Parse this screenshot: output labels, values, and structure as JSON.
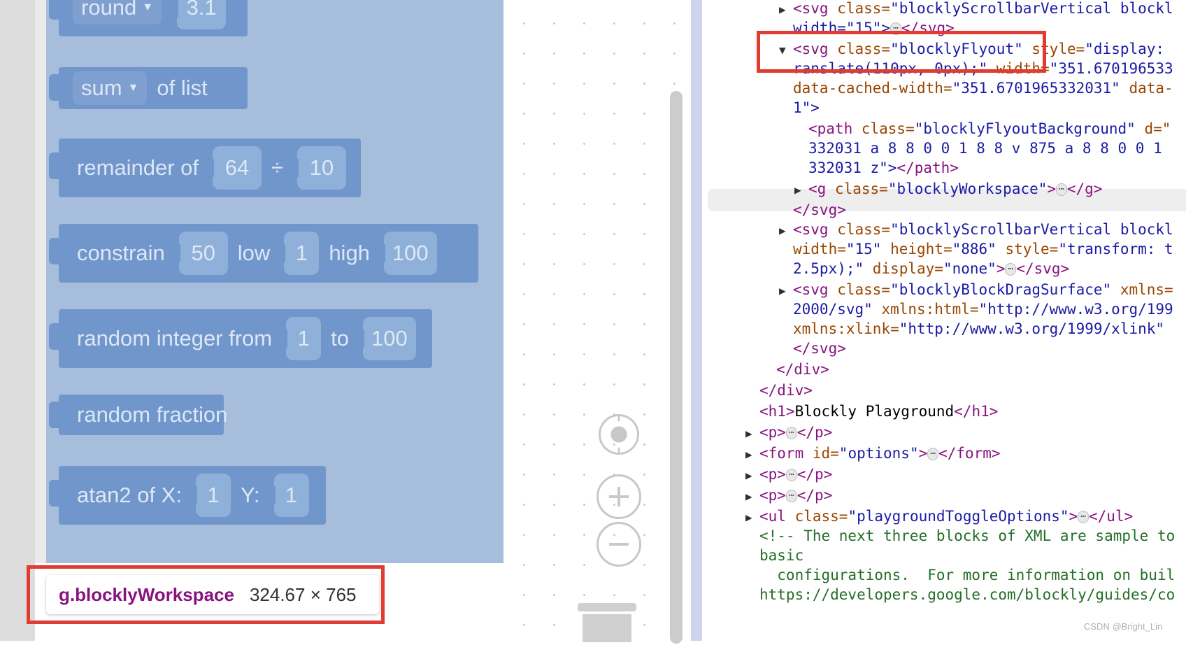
{
  "flyout_blocks": {
    "round": {
      "dropdown": "round",
      "value": "3.1"
    },
    "sum": {
      "dropdown": "sum",
      "label": "of list"
    },
    "remainder": {
      "label": "remainder of",
      "a": "64",
      "op": "÷",
      "b": "10"
    },
    "constrain": {
      "label": "constrain",
      "value": "50",
      "low_label": "low",
      "low": "1",
      "high_label": "high",
      "high": "100"
    },
    "random_int": {
      "label": "random integer from",
      "from": "1",
      "to_label": "to",
      "to": "100"
    },
    "random_fraction": {
      "label": "random fraction"
    },
    "atan2": {
      "label": "atan2 of X:",
      "x": "1",
      "y_label": "Y:",
      "y": "1"
    }
  },
  "tooltip": {
    "name": "g.blocklyWorkspace",
    "dims": "324.67 × 765"
  },
  "workspace_controls": {
    "recenter_icon": "target-icon",
    "zoom_in_icon": "plus-icon",
    "zoom_out_icon": "minus-icon",
    "trash_icon": "trash-icon"
  },
  "devtools": {
    "l1": {
      "tag_open": "<svg",
      "attr": " class=",
      "val": "\"blocklyScrollbarVertical blockl"
    },
    "l2": {
      "val": "width=\"15\">",
      "tag_close": "</svg>"
    },
    "l3": {
      "tag_open": "<svg",
      "attr": " class=",
      "val": "\"blocklyFlyout\"",
      "attr2": " style=",
      "val2": "\"display:"
    },
    "l4": {
      "val": "ranslate(110px, 0px);\"",
      "attr": " width=",
      "val2": "\"351.670196533"
    },
    "l5": {
      "attr": "data-cached-width=",
      "val": "\"351.6701965332031\"",
      "attr2": " data-"
    },
    "l6": {
      "val": "1\">"
    },
    "l7": {
      "tag_open": "<path",
      "attr": " class=",
      "val": "\"blocklyFlyoutBackground\"",
      "attr2": " d=\""
    },
    "l8": {
      "val": "332031 a 8 8 0 0 1 8 8 v 875 a 8 8 0 0 1"
    },
    "l9": {
      "val": "332031 z\">",
      "tag_close": "</path>"
    },
    "l10": {
      "tag_open": "<g",
      "attr": " class=",
      "val": "\"blocklyWorkspace\"",
      "tag_mid": ">",
      "tag_close": "</g>"
    },
    "l11": {
      "tag_close": "</svg>"
    },
    "l12": {
      "tag_open": "<svg",
      "attr": " class=",
      "val": "\"blocklyScrollbarVertical blockl"
    },
    "l13": {
      "attr": "width=",
      "val": "\"15\"",
      "attr2": " height=",
      "val2": "\"886\"",
      "attr3": " style=",
      "val3": "\"transform: t"
    },
    "l14": {
      "val": "2.5px);\"",
      "attr": " display=",
      "val2": "\"none\"",
      "tag_mid": ">",
      "tag_close": "</svg>"
    },
    "l15": {
      "tag_open": "<svg",
      "attr": " class=",
      "val": "\"blocklyBlockDragSurface\"",
      "attr2": " xmlns="
    },
    "l16": {
      "val": "2000/svg\"",
      "attr": " xmlns:html=",
      "val2": "\"http://www.w3.org/199"
    },
    "l17": {
      "attr": "xmlns:xlink=",
      "val": "\"http://www.w3.org/1999/xlink\""
    },
    "l18": {
      "tag_close": "</svg>"
    },
    "l19": {
      "tag_close": "</div>"
    },
    "l20": {
      "tag_close": "</div>"
    },
    "l21": {
      "tag_open": "<h1>",
      "text": "Blockly Playground",
      "tag_close": "</h1>"
    },
    "l22": {
      "tag_open": "<p>",
      "tag_close": "</p>"
    },
    "l23": {
      "tag_open": "<form",
      "attr": " id=",
      "val": "\"options\"",
      "tag_mid": ">",
      "tag_close": "</form>"
    },
    "l24": {
      "tag_open": "<p>",
      "tag_close": "</p>"
    },
    "l25": {
      "tag_open": "<p>",
      "tag_close": "</p>"
    },
    "l26": {
      "tag_open": "<ul",
      "attr": " class=",
      "val": "\"playgroundToggleOptions\"",
      "tag_mid": ">",
      "tag_close": "</ul>"
    },
    "l27": {
      "comment": "<!-- The next three blocks of XML are sample to"
    },
    "l28": {
      "comment": "basic"
    },
    "l29": {
      "comment": "  configurations.  For more information on buil"
    },
    "l30": {
      "comment": "https://developers.google.com/blockly/guides/co"
    },
    "ellipsis": "⋯",
    "triangle_collapsed": "▶",
    "triangle_expanded": "▼"
  },
  "watermark": "CSDN @Bright_Lin",
  "colors": {
    "block": "#7096cb",
    "highlight": "#a6bddc",
    "annotation_red": "#e03c31",
    "tag": "#881280",
    "attr": "#994500",
    "val": "#1a1aa6"
  }
}
